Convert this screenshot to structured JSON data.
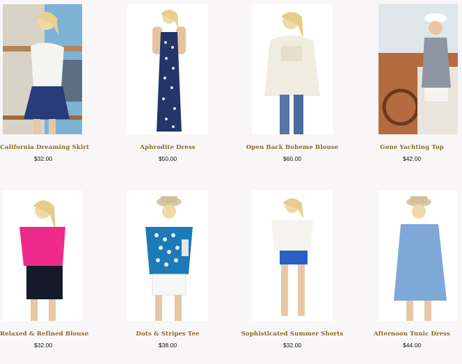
{
  "products": [
    {
      "name": "California Dreaming Skirt",
      "price": "$32.00"
    },
    {
      "name": "Aphrodite Dress",
      "price": "$50.00"
    },
    {
      "name": "Open Back Boheme Blouse",
      "price": "$60.00"
    },
    {
      "name": "Gone Yachting Top",
      "price": "$42.00"
    },
    {
      "name": "Relaxed & Refined Blouse",
      "price": "$32.00"
    },
    {
      "name": "Dots & Stripes Tee",
      "price": "$38.00"
    },
    {
      "name": "Sophisticated Summer Shorts",
      "price": "$32.00"
    },
    {
      "name": "Afternoon Tunic Dress",
      "price": "$44.00"
    }
  ],
  "colors": {
    "product_name": "#8a6a2a",
    "price": "#111111",
    "background": "#f8f6f7"
  }
}
